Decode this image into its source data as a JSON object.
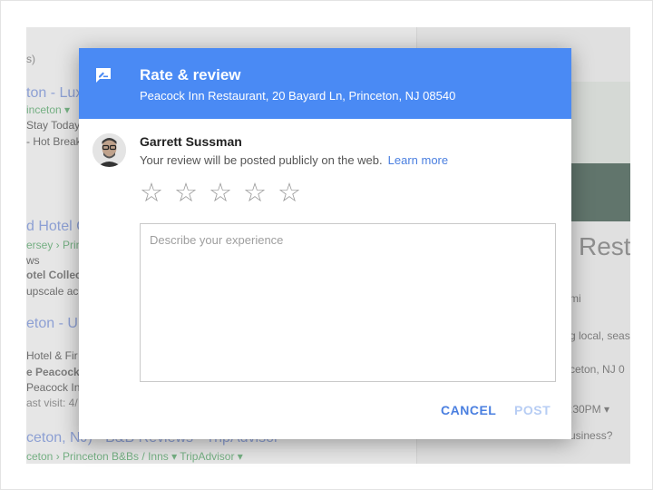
{
  "background": {
    "lines": [
      "s)",
      "ton - Lux",
      "inceton ▾",
      "Stay Today",
      "- Hot Break",
      "d Hotel C",
      "ersey › Prin",
      "ws",
      "otel Collect",
      "upscale ac",
      "eton - U",
      "Hotel & Fir",
      "e Peacock",
      "Peacock In",
      "ast visit: 4/",
      "ceton, NJ) - B&B Reviews - TripAdvisor",
      "ceton › Princeton B&Bs / Inns ▾  TripAdvisor ▾"
    ],
    "right": {
      "title": "Rest",
      "lines": [
        "mi",
        "g local, seas",
        "ceton, NJ 0",
        ":30PM ▾",
        "usiness?"
      ]
    }
  },
  "dialog": {
    "header": {
      "icon": "rate-review-icon",
      "title": "Rate & review",
      "subtitle": "Peacock Inn Restaurant, 20 Bayard Ln, Princeton, NJ 08540"
    },
    "user": {
      "name": "Garrett Sussman",
      "notice": "Your review will be posted publicly on the web.",
      "learn_more": "Learn more"
    },
    "rating": {
      "value": 0,
      "max": 5,
      "star_glyph": "☆"
    },
    "review": {
      "value": "",
      "placeholder": "Describe your experience"
    },
    "buttons": {
      "cancel": "CANCEL",
      "post": "POST"
    }
  },
  "colors": {
    "header_bg": "#4a8af4",
    "link": "#4a7fe0",
    "post_disabled": "#b7cdf4"
  }
}
